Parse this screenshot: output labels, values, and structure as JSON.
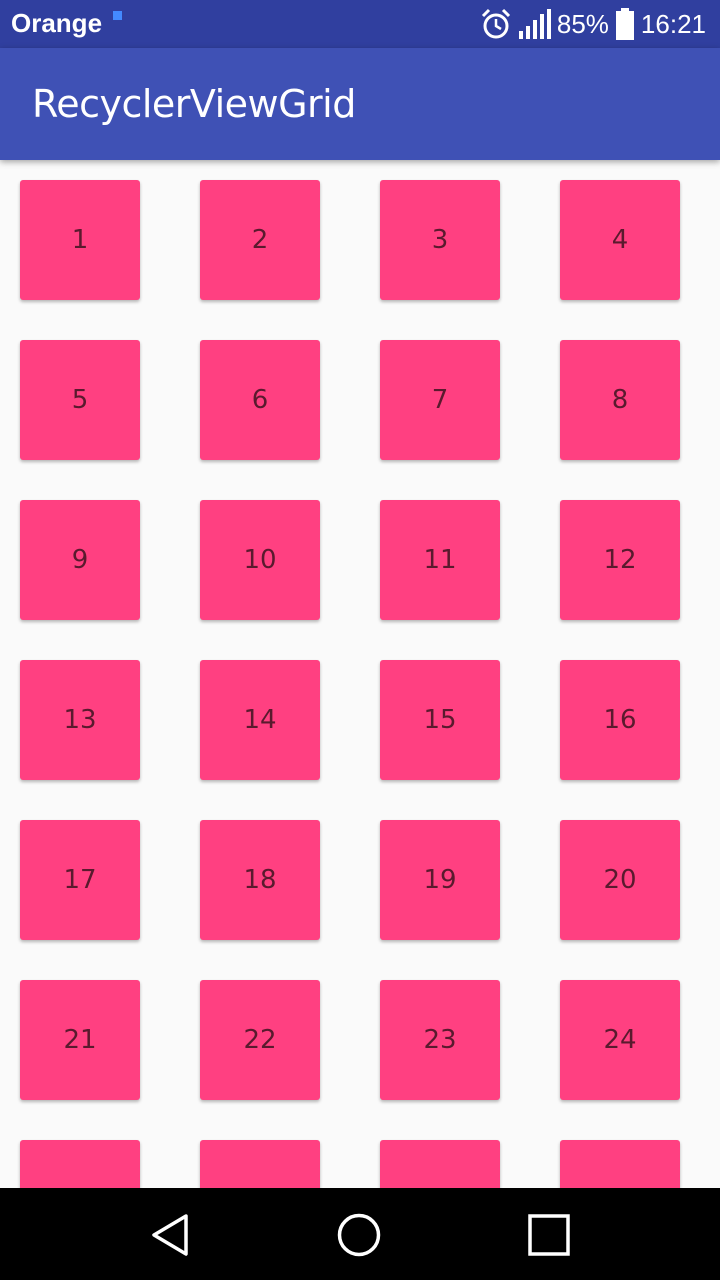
{
  "status_bar": {
    "carrier": "Orange",
    "battery_percent": "85%",
    "time": "16:21",
    "icons": [
      "alarm-icon",
      "signal-icon",
      "battery-icon"
    ],
    "background": "#303f9f"
  },
  "app_bar": {
    "title": "RecyclerViewGrid",
    "background": "#3f51b5"
  },
  "grid": {
    "columns": 4,
    "cell_color": "#ff4081",
    "items": [
      "1",
      "2",
      "3",
      "4",
      "5",
      "6",
      "7",
      "8",
      "9",
      "10",
      "11",
      "12",
      "13",
      "14",
      "15",
      "16",
      "17",
      "18",
      "19",
      "20",
      "21",
      "22",
      "23",
      "24",
      "",
      "",
      "",
      ""
    ]
  },
  "nav_bar": {
    "buttons": [
      "back-icon",
      "home-icon",
      "recents-icon"
    ]
  }
}
